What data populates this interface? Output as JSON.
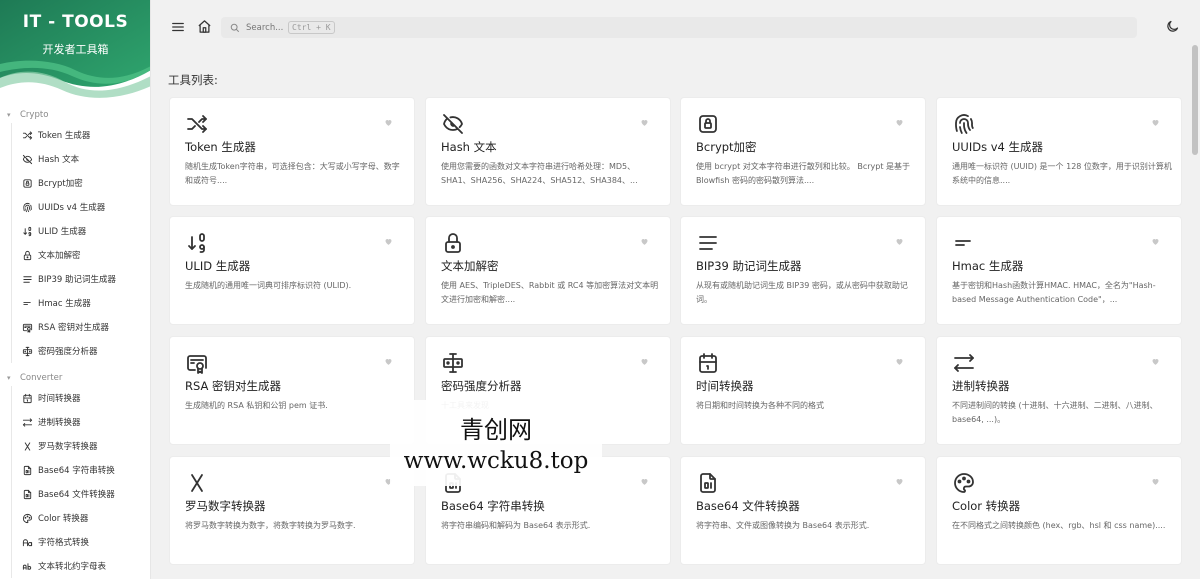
{
  "brand": {
    "title": "IT - TOOLS",
    "subtitle": "开发者工具箱"
  },
  "search": {
    "placeholder": "Search...",
    "shortcut": "Ctrl + K"
  },
  "section_title": "工具列表:",
  "sidebar": {
    "groups": [
      {
        "label": "Crypto",
        "items": [
          {
            "label": "Token 生成器",
            "icon": "shuffle-icon"
          },
          {
            "label": "Hash 文本",
            "icon": "eye-off-icon"
          },
          {
            "label": "Bcrypt加密",
            "icon": "lock-square-icon"
          },
          {
            "label": "UUIDs v4 生成器",
            "icon": "fingerprint-icon"
          },
          {
            "label": "ULID 生成器",
            "icon": "sort-numeric-icon"
          },
          {
            "label": "文本加解密",
            "icon": "lock-icon"
          },
          {
            "label": "BIP39 助记词生成器",
            "icon": "align-justified-icon"
          },
          {
            "label": "Hmac 生成器",
            "icon": "short-text-icon"
          },
          {
            "label": "RSA 密钥对生成器",
            "icon": "certificate-icon"
          },
          {
            "label": "密码强度分析器",
            "icon": "password-icon"
          }
        ]
      },
      {
        "label": "Converter",
        "items": [
          {
            "label": "时间转换器",
            "icon": "calendar-icon"
          },
          {
            "label": "进制转换器",
            "icon": "arrows-left-right-icon"
          },
          {
            "label": "罗马数字转换器",
            "icon": "letter-x-icon"
          },
          {
            "label": "Base64 字符串转换",
            "icon": "file-digit-icon"
          },
          {
            "label": "Base64 文件转换器",
            "icon": "file-digit-icon"
          },
          {
            "label": "Color 转换器",
            "icon": "palette-icon"
          },
          {
            "label": "字符格式转换",
            "icon": "letter-case-icon"
          },
          {
            "label": "文本转北约字母表",
            "icon": "alphabet-icon"
          }
        ]
      }
    ]
  },
  "cards": [
    {
      "title": "Token 生成器",
      "icon": "shuffle-icon",
      "desc": "随机生成Token字符串，可选择包含：大写或小写字母、数字和或符号...."
    },
    {
      "title": "Hash 文本",
      "icon": "eye-off-icon",
      "desc": "使用您需要的函数对文本字符串进行哈希处理：MD5、SHA1、SHA256、SHA224、SHA512、SHA384、..."
    },
    {
      "title": "Bcrypt加密",
      "icon": "lock-square-icon",
      "desc": "使用 bcrypt 对文本字符串进行散列和比较。 Bcrypt 是基于 Blowfish 密码的密码散列算法...."
    },
    {
      "title": "UUIDs v4 生成器",
      "icon": "fingerprint-icon",
      "desc": "通用唯一标识符 (UUID) 是一个 128 位数字，用于识别计算机系统中的信息...."
    },
    {
      "title": "ULID 生成器",
      "icon": "sort-numeric-icon",
      "desc": "生成随机的通用唯一词典可排序标识符 (ULID)."
    },
    {
      "title": "文本加解密",
      "icon": "lock-icon",
      "desc": "使用 AES、TripleDES、Rabbit 或 RC4 等加密算法对文本明文进行加密和解密...."
    },
    {
      "title": "BIP39 助记词生成器",
      "icon": "align-justified-icon",
      "desc": "从现有或随机助记词生成 BIP39 密码，或从密码中获取助记词。"
    },
    {
      "title": "Hmac 生成器",
      "icon": "short-text-icon",
      "desc": "基于密钥和Hash函数计算HMAC. HMAC，全名为\"Hash-based Message Authentication Code\"，..."
    },
    {
      "title": "RSA 密钥对生成器",
      "icon": "certificate-icon",
      "desc": "生成随机的 RSA 私钥和公钥 pem 证书."
    },
    {
      "title": "密码强度分析器",
      "icon": "password-icon",
      "desc": "十工具来发现"
    },
    {
      "title": "时间转换器",
      "icon": "calendar-icon",
      "desc": "将日期和时间转换为各种不同的格式"
    },
    {
      "title": "进制转换器",
      "icon": "arrows-left-right-icon",
      "desc": "不同进制间的转换 (十进制、十六进制、二进制、八进制、base64, ...)。"
    },
    {
      "title": "罗马数字转换器",
      "icon": "letter-x-icon",
      "desc": "将罗马数字转换为数字，将数字转换为罗马数字."
    },
    {
      "title": "Base64 字符串转换",
      "icon": "file-digit-icon",
      "desc": "将字符串编码和解码为 Base64 表示形式."
    },
    {
      "title": "Base64 文件转换器",
      "icon": "file-digit-icon",
      "desc": "将字符串、文件或图像转换为 Base64 表示形式."
    },
    {
      "title": "Color 转换器",
      "icon": "palette-icon",
      "desc": "在不同格式之间转换颜色 (hex、rgb、hsl 和 css name)...."
    }
  ],
  "watermark": {
    "line1": "青创网",
    "line2": "www.wcku8.top"
  },
  "colors": {
    "brand_green": "#2a9d66",
    "brand_dark": "#1f6e52",
    "accent_light": "#9bd3b6"
  }
}
